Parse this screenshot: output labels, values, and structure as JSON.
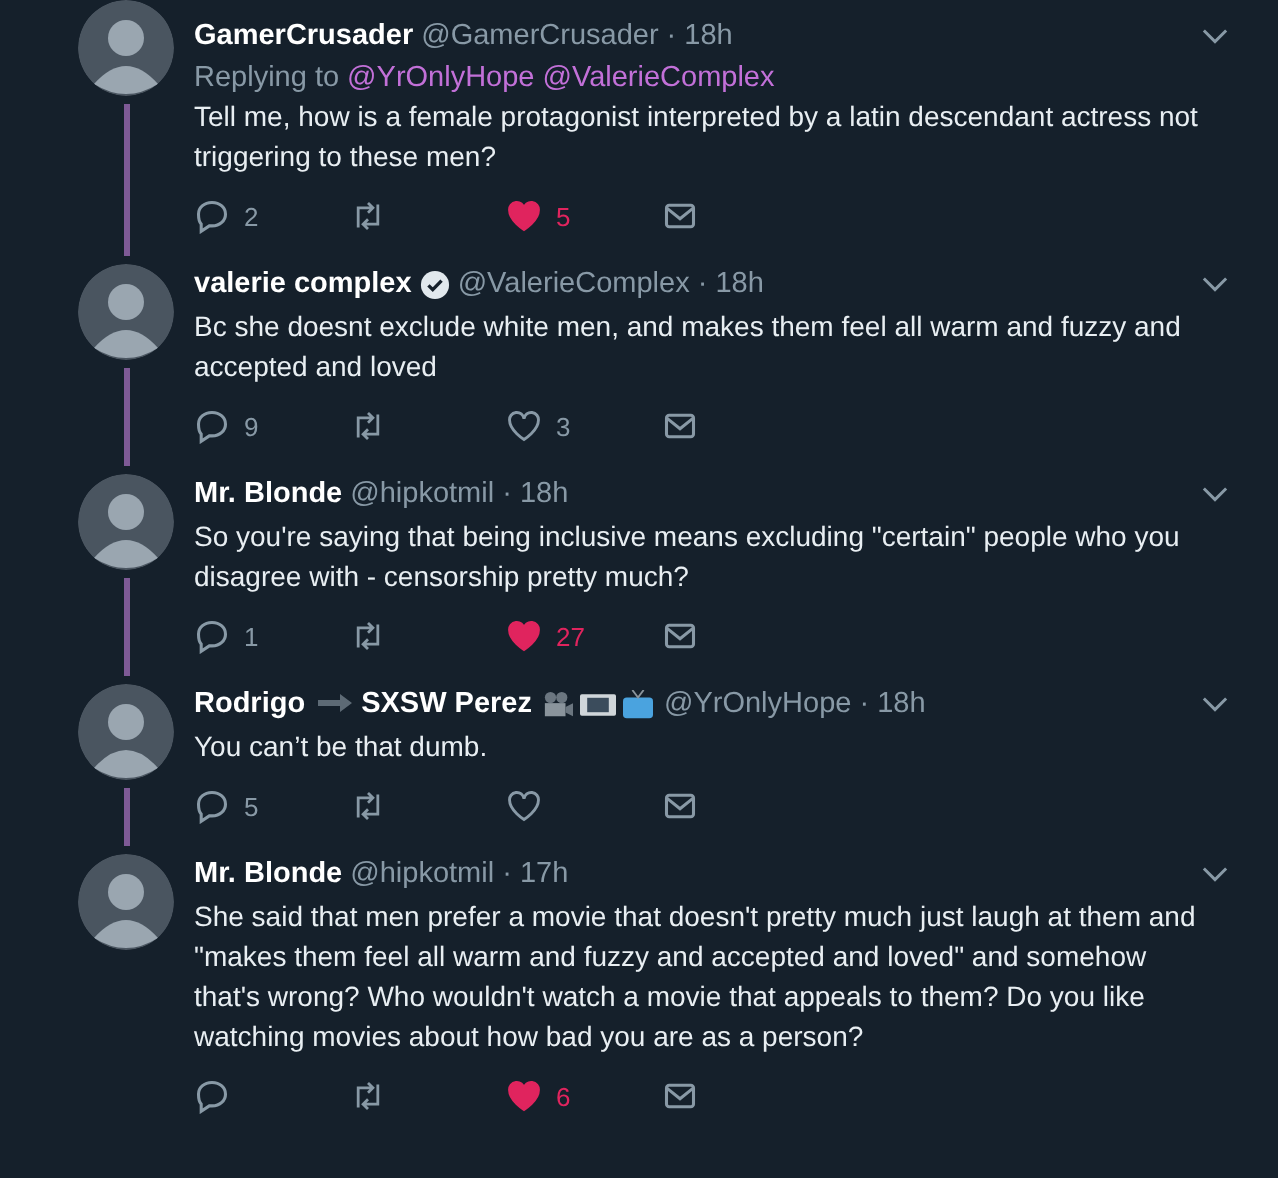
{
  "tweets": [
    {
      "name_parts": [
        "GamerCrusader"
      ],
      "verified": false,
      "emoji_badges": false,
      "handle": "@GamerCrusader",
      "time": "· 18h",
      "replying_to": {
        "label": "Replying to",
        "mentions": [
          "@YrOnlyHope",
          "@ValerieComplex"
        ]
      },
      "text": "Tell me, how is a female protagonist interpreted by a latin descendant actress not triggering to these men?",
      "replies": "2",
      "likes": "5",
      "liked": true,
      "thread_line": true
    },
    {
      "name_parts": [
        "valerie complex"
      ],
      "verified": true,
      "emoji_badges": false,
      "handle": "@ValerieComplex",
      "time": "· 18h",
      "text": "Bc she doesnt exclude white men, and makes them feel all warm and fuzzy and accepted and loved",
      "replies": "9",
      "likes": "3",
      "liked": false,
      "thread_line": true
    },
    {
      "name_parts": [
        "Mr. Blonde"
      ],
      "verified": false,
      "emoji_badges": false,
      "handle": "@hipkotmil",
      "time": "· 18h",
      "text": "So you're saying that being inclusive means excluding \"certain\" people who you disagree with - censorship pretty much?",
      "replies": "1",
      "likes": "27",
      "liked": true,
      "thread_line": true
    },
    {
      "name_parts": [
        "Rodrigo",
        "SXSW Perez"
      ],
      "verified": false,
      "emoji_badges": true,
      "handle": "@YrOnlyHope",
      "time": "· 18h",
      "text": "You can’t be that dumb.",
      "replies": "5",
      "liked": false,
      "thread_line": true
    },
    {
      "name_parts": [
        "Mr. Blonde"
      ],
      "verified": false,
      "emoji_badges": false,
      "handle": "@hipkotmil",
      "time": "· 17h",
      "text": "She said that men prefer a movie that doesn't pretty much just laugh at them and \"makes them feel all warm and fuzzy and accepted and loved\" and somehow that's wrong? Who wouldn't watch a movie that appeals to them? Do you like watching movies about how bad you are as a person?",
      "likes": "6",
      "liked": true,
      "thread_line": false
    }
  ]
}
